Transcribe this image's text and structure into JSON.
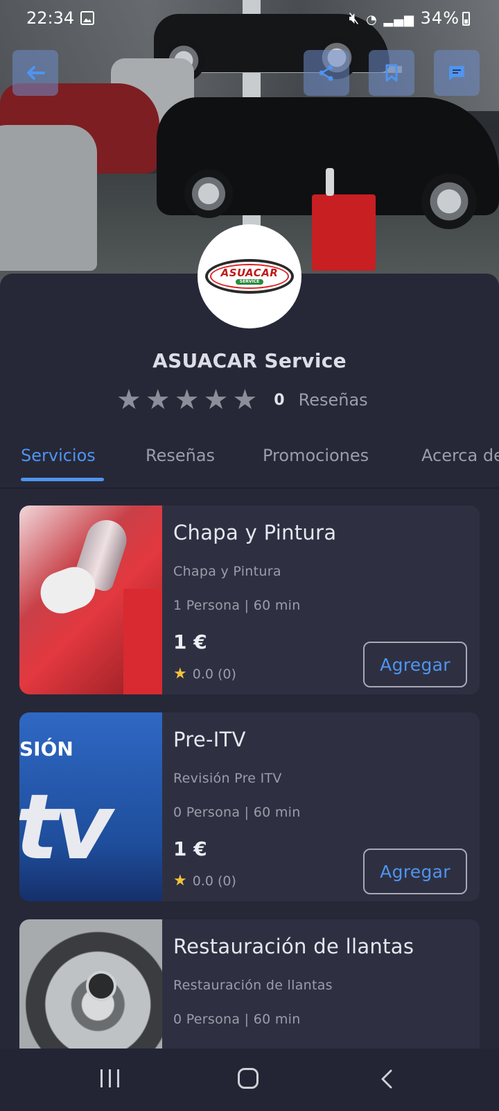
{
  "status_bar": {
    "time": "22:34",
    "right_text": "34%"
  },
  "icons": {
    "back": "arrow-left-icon",
    "share": "share-icon",
    "bookmark": "bookmark-icon",
    "chat": "chat-icon"
  },
  "colors": {
    "accent": "#4f94ef",
    "background": "#262838",
    "card": "#2e3042",
    "star_rating": "#f3c23a"
  },
  "logo": {
    "main": "ASUACAR",
    "sub": "SERVICE"
  },
  "business": {
    "name": "ASUACAR Service",
    "rating_stars": 0,
    "review_count": "0",
    "reviews_label": "Reseñas"
  },
  "tabs": [
    {
      "label": "Servicios",
      "active": true
    },
    {
      "label": "Reseñas",
      "active": false
    },
    {
      "label": "Promociones",
      "active": false
    },
    {
      "label": "Acerca de",
      "active": false
    }
  ],
  "services": [
    {
      "title": "Chapa y Pintura",
      "subtitle": "Chapa y Pintura",
      "meta": "1 Persona | 60 min",
      "price": "1 €",
      "rating": "0.0 (0)",
      "button": "Agregar"
    },
    {
      "title": "Pre-ITV",
      "subtitle": "Revisión Pre ITV",
      "meta": "0 Persona | 60 min",
      "price": "1 €",
      "rating": "0.0 (0)",
      "button": "Agregar",
      "thumb_text": "SIÓN",
      "thumb_big": "tv"
    },
    {
      "title": "Restauración de llantas",
      "subtitle": "Restauración de llantas",
      "meta": "0 Persona | 60 min"
    }
  ]
}
